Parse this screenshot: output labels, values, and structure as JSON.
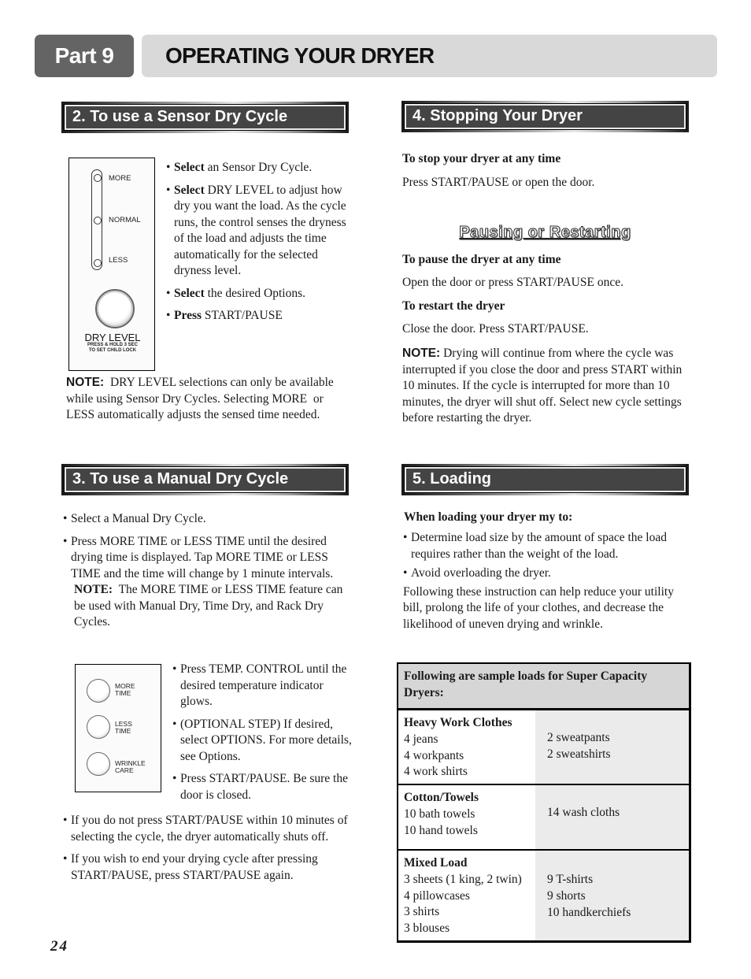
{
  "header": {
    "part_label": "Part 9",
    "title": "OPERATING YOUR DRYER"
  },
  "sensor": {
    "heading": "2. To use a Sensor Dry Cycle",
    "panel": {
      "levels": [
        "MORE",
        "NORMAL",
        "LESS"
      ],
      "button_label": "DRY LEVEL",
      "button_sub1": "PRESS & HOLD 3 SEC",
      "button_sub2": "TO SET CHILD LOCK"
    },
    "steps": [
      {
        "bold": "Select",
        "text": " an Sensor Dry Cycle."
      },
      {
        "bold": "Select",
        "text": " DRY LEVEL to adjust how dry you want the load. As the cycle runs, the control senses the dryness of the load and adjusts the time automatically for the selected dryness level."
      },
      {
        "bold": "Select",
        "text": " the desired Options."
      },
      {
        "bold": "Press",
        "text": " START/PAUSE"
      }
    ],
    "note_label": "NOTE:",
    "note_text": "  DRY LEVEL selections can only be available while using Sensor Dry Cycles. Selecting MORE  or LESS automatically adjusts the sensed time needed."
  },
  "manual": {
    "heading": "3. To use a Manual Dry Cycle",
    "steps_top": [
      "Select a Manual Dry Cycle.",
      "Press MORE TIME or LESS TIME until the desired drying time is displayed. Tap MORE TIME or LESS TIME and the time will change by 1 minute intervals."
    ],
    "inline_note_label": "NOTE:",
    "inline_note_text": "  The MORE TIME or LESS TIME feature can be used with Manual Dry, Time Dry, and Rack Dry Cycles.",
    "panel": {
      "buttons": [
        {
          "line1": "MORE",
          "line2": "TIME"
        },
        {
          "line1": "LESS",
          "line2": "TIME"
        },
        {
          "line1": "WRINKLE",
          "line2": "CARE"
        }
      ]
    },
    "steps_side": [
      "Press TEMP. CONTROL until the desired temperature indicator glows.",
      "(OPTIONAL STEP) If desired, select OPTIONS. For more details, see Options.",
      "Press START/PAUSE. Be sure the door is closed."
    ],
    "steps_bottom": [
      "If you do not press START/PAUSE within 10 minutes of selecting the cycle, the dryer automatically shuts off.",
      "If you wish to end your drying cycle after pressing START/PAUSE, press START/PAUSE again."
    ]
  },
  "stopping": {
    "heading": "4. Stopping Your Dryer",
    "stop_title": "To stop your dryer at any time",
    "stop_text": "Press START/PAUSE or open the door.",
    "pausing_heading": "Pausing or Restarting",
    "pause_title": "To pause the dryer at any time",
    "pause_text": "Open the door or press START/PAUSE once.",
    "restart_title": "To restart the dryer",
    "restart_text": "Close the door. Press START/PAUSE.",
    "note_label": "NOTE:",
    "note_text": " Drying will continue from where the cycle was interrupted if you close the door and press START within 10 minutes. If the cycle is interrupted for more than 10 minutes, the dryer will shut off. Select new cycle settings before restarting the dryer."
  },
  "loading": {
    "heading": "5. Loading",
    "intro_title": "When loading your dryer my to:",
    "bullets": [
      "Determine load size by the amount of space the load requires rather than the weight of the load.",
      "Avoid overloading the dryer."
    ],
    "paragraph": "Following these instruction can help reduce your utility bill, prolong the life of your clothes, and decrease the likelihood of uneven drying and wrinkle.",
    "table": {
      "header": "Following are sample loads for Super Capacity Dryers:",
      "rows": [
        {
          "title": "Heavy Work Clothes",
          "left": [
            "4 jeans",
            "4 workpants",
            "4 work shirts"
          ],
          "right": [
            "2 sweatpants",
            "2 sweatshirts"
          ]
        },
        {
          "title": "Cotton/Towels",
          "left": [
            "10 bath towels",
            "10 hand towels"
          ],
          "right": [
            "14 wash cloths"
          ]
        },
        {
          "title": "Mixed Load",
          "left": [
            "3 sheets (1 king, 2 twin)",
            "4 pillowcases",
            "3 shirts",
            "3 blouses"
          ],
          "right": [
            "9 T-shirts",
            "9 shorts",
            "10 handkerchiefs"
          ]
        }
      ]
    }
  },
  "footer": {
    "page_number": "24"
  }
}
